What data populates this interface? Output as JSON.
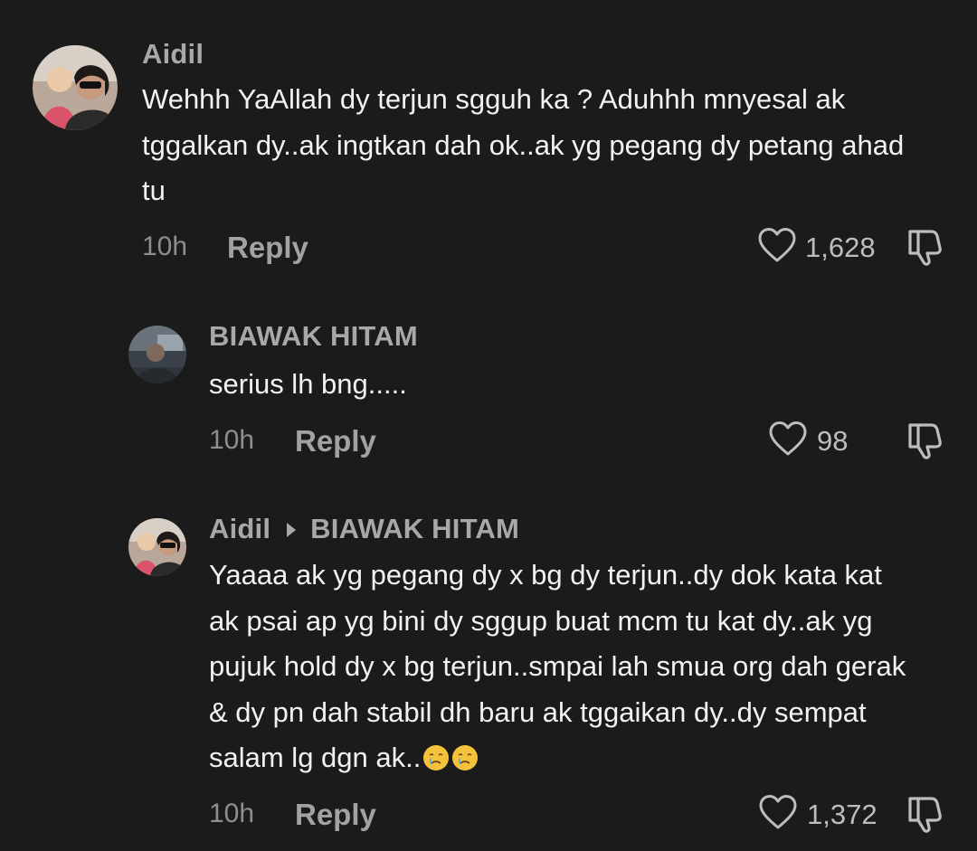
{
  "comments": [
    {
      "username": "Aidil",
      "text": "Wehhh YaAllah dy terjun sgguh ka ? Aduhhh mnyesal ak\ntggalkan dy..ak ingtkan dah ok..ak yg pegang dy petang ahad\ntu",
      "time": "10h",
      "reply_label": "Reply",
      "likes": "1,628",
      "avatar_icon": "profile-photo"
    },
    {
      "username": "BIAWAK HITAM",
      "text": "serius lh bng.....",
      "time": "10h",
      "reply_label": "Reply",
      "likes": "98",
      "avatar_icon": "profile-photo"
    },
    {
      "username": "Aidil",
      "reply_to": "BIAWAK HITAM",
      "text": "Yaaaa ak yg pegang dy x bg dy terjun..dy dok kata kat\nak psai ap yg bini dy sggup buat mcm tu kat dy..ak yg\npujuk hold dy x bg terjun..smpai lah smua org dah gerak\n& dy pn dah stabil dh baru ak tggaikan dy..dy sempat\nsalam lg dgn ak..",
      "emoji": [
        "crying-face",
        "crying-face"
      ],
      "time": "10h",
      "reply_label": "Reply",
      "likes": "1,372",
      "avatar_icon": "profile-photo"
    }
  ],
  "colors": {
    "background": "#1b1b1b",
    "username": "#a8a8a8",
    "text": "#f2f2f2",
    "meta": "#8e8e8e"
  }
}
